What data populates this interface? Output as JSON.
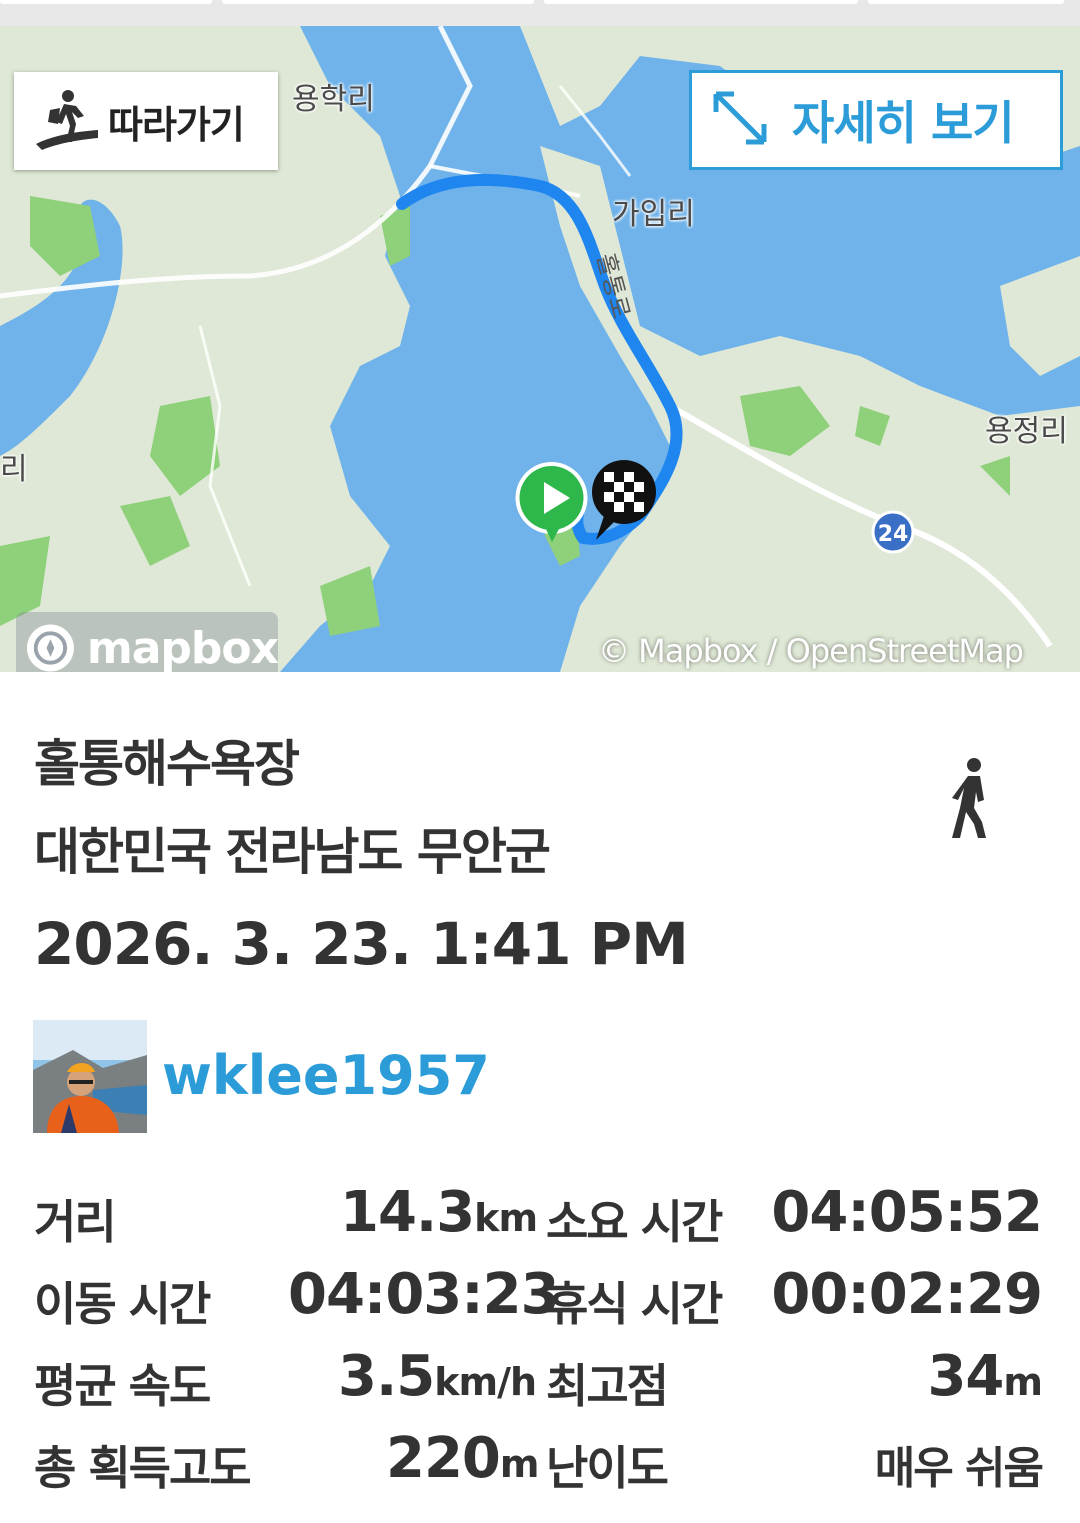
{
  "map": {
    "follow_label": "따라가기",
    "detail_label": "자세히 보기",
    "places": {
      "yonghak": "용학리",
      "gaip": "가입리",
      "yongjeong": "용정리",
      "edge_left": "리",
      "road_label": "홀통로"
    },
    "highway_number": "24",
    "mapbox_logo": "mapbox",
    "attribution": "© Mapbox / OpenStreetMap",
    "route_color": "#1f86f0",
    "water_color": "#6fb3ea",
    "land_color": "#dfe8d6",
    "park_color": "#8fd07a",
    "icons": {
      "follow": "hiker-icon",
      "detail": "expand-arrows-icon",
      "start": "play-marker-icon",
      "finish": "checkered-flag-icon"
    }
  },
  "trip": {
    "title": "홀통해수욕장",
    "address": "대한민국 전라남도 무안군",
    "datetime": "2026. 3. 23. 1:41 PM",
    "activity_icon": "walking-person-icon"
  },
  "user": {
    "name": "wklee1957",
    "accent": "#2b9cd8"
  },
  "stats": {
    "distance_label": "거리",
    "distance_value": "14.3",
    "distance_unit": "km",
    "duration_label": "소요 시간",
    "duration_value": "04:05:52",
    "moving_label": "이동 시간",
    "moving_value": "04:03:23",
    "rest_label": "휴식 시간",
    "rest_value": "00:02:29",
    "speed_label": "평균 속도",
    "speed_value": "3.5",
    "speed_unit": "km/h",
    "max_alt_label": "최고점",
    "max_alt_value": "34",
    "max_alt_unit": "m",
    "gain_label": "총 획득고도",
    "gain_value": "220",
    "gain_unit": "m",
    "difficulty_label": "난이도",
    "difficulty_value": "매우 쉬움"
  }
}
